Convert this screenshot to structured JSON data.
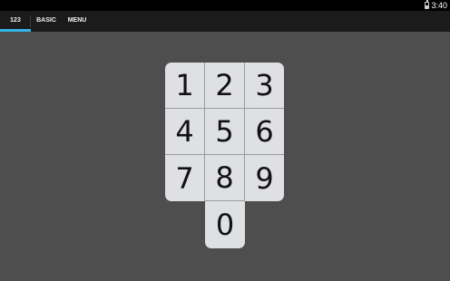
{
  "status_bar": {
    "time": "3:40",
    "battery_icon": "battery-icon"
  },
  "tabs": [
    {
      "label": "123",
      "selected": true
    },
    {
      "label": "BASIC",
      "selected": false
    },
    {
      "label": "MENU",
      "selected": false
    }
  ],
  "keypad": {
    "keys": [
      "1",
      "2",
      "3",
      "4",
      "5",
      "6",
      "7",
      "8",
      "9",
      "0"
    ]
  },
  "colors": {
    "background": "#4e4e4e",
    "tab_bar": "#1b1b1b",
    "accent": "#33b5e5",
    "key": "#dfe0e4"
  }
}
